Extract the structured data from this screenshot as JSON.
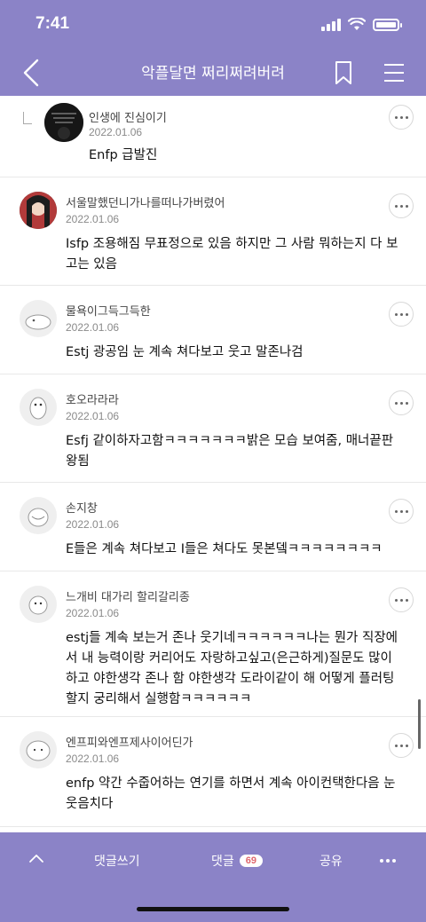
{
  "status": {
    "time": "7:41"
  },
  "header": {
    "title": "악플달면 쩌리쩌려버려"
  },
  "comments": [
    {
      "nick": "인생에 진심이기",
      "date": "2022.01.06",
      "text": "Enfp 급발진",
      "reply": true
    },
    {
      "nick": "서울말했던니가나를떠나가버렸어",
      "date": "2022.01.06",
      "text": "Isfp 조용해짐 무표정으로 있음 하지만 그 사람 뭐하는지 다 보고는 있음"
    },
    {
      "nick": "물욕이그득그득한",
      "date": "2022.01.06",
      "text": "Estj 광공임 눈 계속 쳐다보고 웃고 말존나검"
    },
    {
      "nick": "호오라라라",
      "date": "2022.01.06",
      "text": "Esfj 같이하자고함ㅋㅋㅋㅋㅋㅋㅋ밝은 모습 보여줌, 매너끝판왕됨"
    },
    {
      "nick": "손지창",
      "date": "2022.01.06",
      "text": "E들은 계속 쳐다보고 I들은 쳐다도 못본뎈ㅋㅋㅋㅋㅋㅋㅋㅋ"
    },
    {
      "nick": "느개비 대가리 할리갈리종",
      "date": "2022.01.06",
      "text": "estj들 계속 보는거 존나 웃기네ㅋㅋㅋㅋㅋㅋ나는 뭔가 직장에서 내 능력이랑 커리어도 자랑하고싶고(은근하게)질문도 많이하고 야한생각 존나 함 야한생각 도라이같이 해 어떻게 플러팅할지 궁리해서 실행함ㅋㅋㅋㅋㅋㅋ"
    },
    {
      "nick": "엔프피와엔프제사이어딘가",
      "date": "2022.01.06",
      "text": "enfp 약간 수줍어하는 연기를 하면서 계속 아이컨택한다음 눈웃음치다"
    }
  ],
  "bottom": {
    "write_label": "댓글쓰기",
    "comments_label": "댓글",
    "comments_count": "69",
    "share_label": "공유"
  },
  "colors": {
    "bar": "#8b83c7",
    "badge_text": "#e0686e"
  }
}
